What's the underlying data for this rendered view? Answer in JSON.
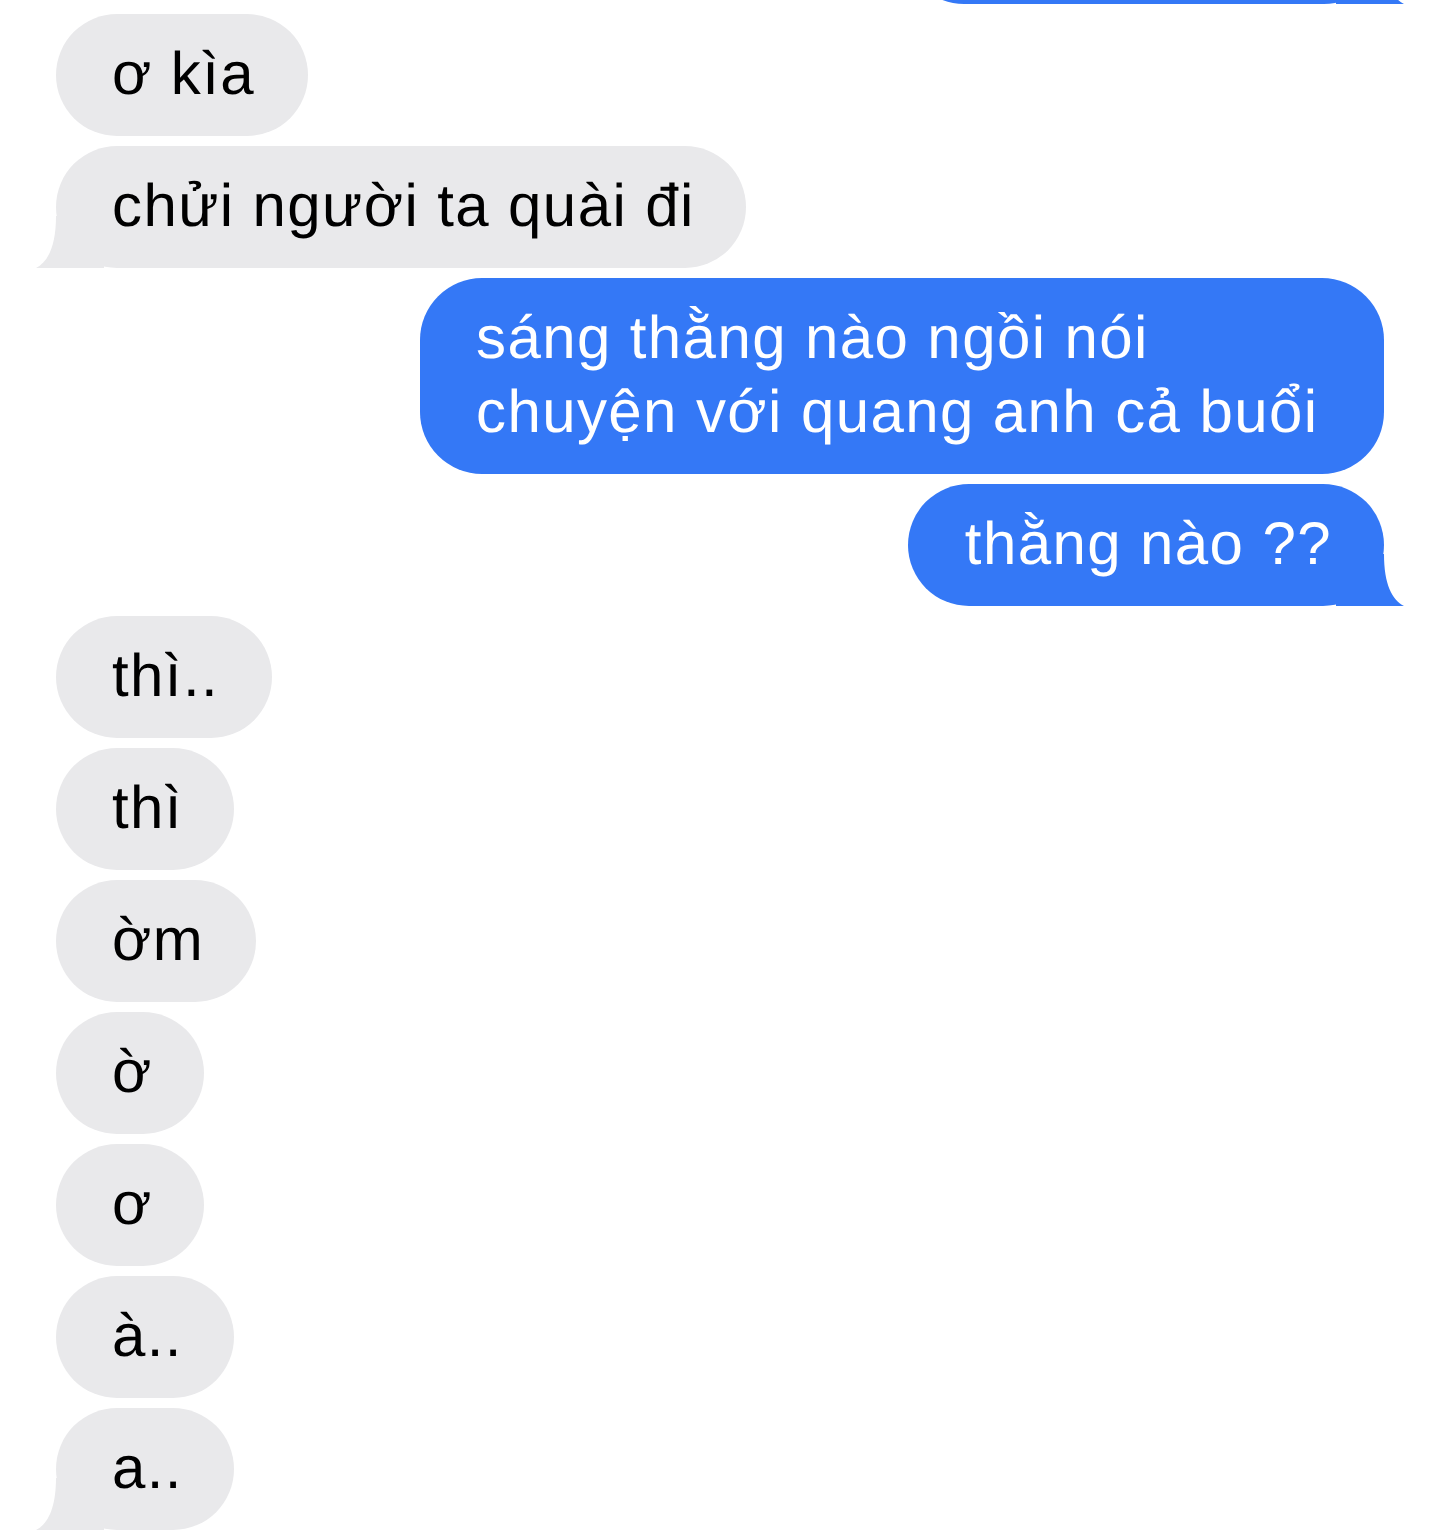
{
  "messages": [
    {
      "kind": "sent",
      "tail": true
    },
    {
      "kind": "received",
      "text": "ơ kìa",
      "tail": false
    },
    {
      "kind": "received",
      "text": "chửi người ta quài đi",
      "tail": true
    },
    {
      "kind": "sent",
      "text": "sáng thằng nào ngồi nói chuyện với quang anh cả buổi",
      "tail": false
    },
    {
      "kind": "sent",
      "text": "thằng nào ??",
      "tail": true
    },
    {
      "kind": "received",
      "text": "thì..",
      "tail": false
    },
    {
      "kind": "received",
      "text": "thì",
      "tail": false
    },
    {
      "kind": "received",
      "text": "ờm",
      "tail": false
    },
    {
      "kind": "received",
      "text": "ờ",
      "tail": false
    },
    {
      "kind": "received",
      "text": "ơ",
      "tail": false
    },
    {
      "kind": "received",
      "text": "à..",
      "tail": false
    },
    {
      "kind": "received",
      "text": "a..",
      "tail": true
    }
  ]
}
